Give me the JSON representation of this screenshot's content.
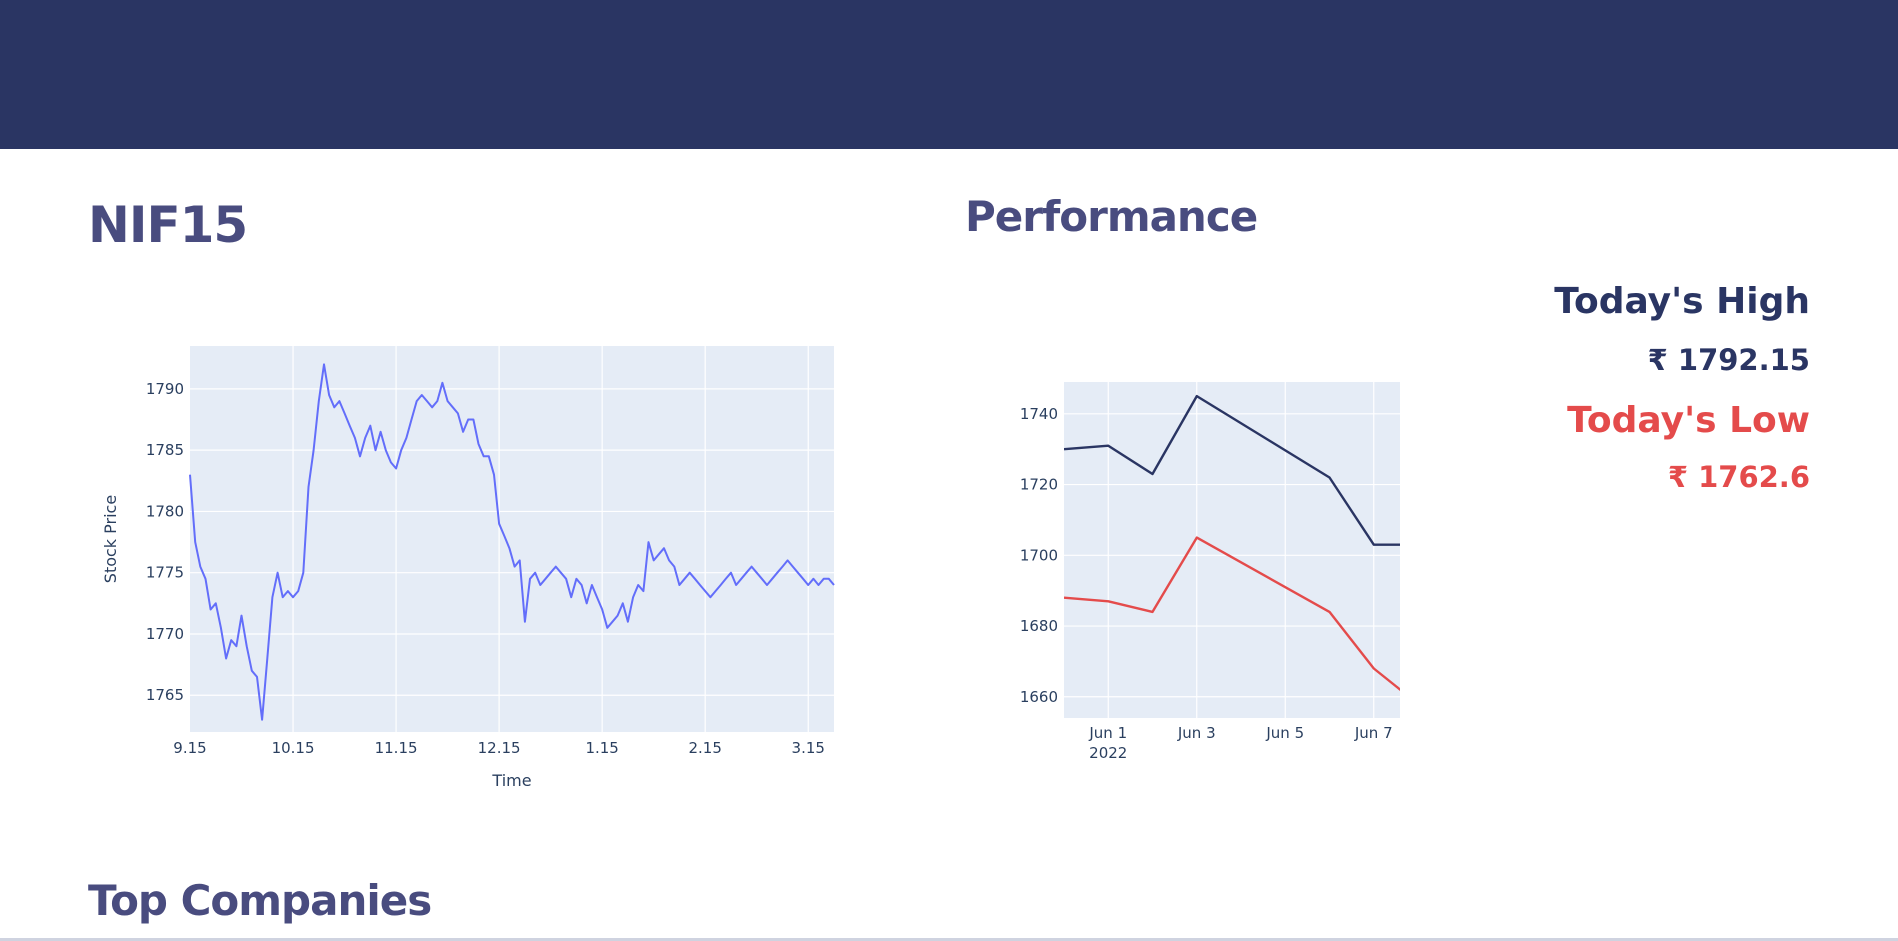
{
  "header": {
    "color": "#2a3563"
  },
  "ticker": "NIF15",
  "performance_title": "Performance",
  "stats": {
    "high_label": "Today's High",
    "high_value": "₹ 1792.15",
    "low_label": "Today's Low",
    "low_value": "₹ 1762.6",
    "high_color": "#2a3563",
    "low_color": "#e44b4b"
  },
  "section_title": "Top Companies",
  "chart_data": [
    {
      "type": "line",
      "title": "",
      "xlabel": "Time",
      "ylabel": "Stock Price",
      "x_ticks": [
        "9.15",
        "10.15",
        "11.15",
        "12.15",
        "1.15",
        "2.15",
        "3.15"
      ],
      "y_ticks": [
        1765,
        1770,
        1775,
        1780,
        1785,
        1790
      ],
      "xlim": [
        9.25,
        15.5
      ],
      "ylim": [
        1762.0,
        1793.5
      ],
      "line_color": "#636efa",
      "grid": true,
      "series": [
        {
          "x": [
            9.25,
            9.3,
            9.35,
            9.4,
            9.45,
            9.5,
            9.55,
            9.6,
            9.65,
            9.7,
            9.75,
            9.8,
            9.85,
            9.9,
            9.95,
            10.0,
            10.05,
            10.1,
            10.15,
            10.2,
            10.25,
            10.3,
            10.35,
            10.4,
            10.45,
            10.5,
            10.55,
            10.6,
            10.65,
            10.7,
            10.75,
            10.8,
            10.85,
            10.9,
            10.95,
            11.0,
            11.05,
            11.1,
            11.15,
            11.2,
            11.25,
            11.3,
            11.35,
            11.4,
            11.45,
            11.5,
            11.55,
            11.6,
            11.65,
            11.7,
            11.75,
            11.8,
            11.85,
            11.9,
            11.95,
            12.0,
            12.05,
            12.1,
            12.15,
            12.2,
            12.25,
            12.3,
            12.35,
            12.4,
            12.45,
            12.5,
            12.55,
            12.6,
            12.65,
            12.7,
            12.75,
            12.8,
            12.85,
            12.9,
            12.95,
            13.0,
            13.05,
            13.1,
            13.15,
            13.2,
            13.25,
            13.3,
            13.35,
            13.4,
            13.45,
            13.5,
            13.55,
            13.6,
            13.65,
            13.7,
            13.75,
            13.8,
            13.85,
            13.9,
            13.95,
            14.0,
            14.05,
            14.1,
            14.15,
            14.2,
            14.25,
            14.3,
            14.35,
            14.4,
            14.45,
            14.5,
            14.55,
            14.6,
            14.65,
            14.7,
            14.75,
            14.8,
            14.85,
            14.9,
            14.95,
            15.0,
            15.05,
            15.1,
            15.15,
            15.2,
            15.25,
            15.3,
            15.35,
            15.4,
            15.45,
            15.5
          ],
          "values": [
            1783.0,
            1777.5,
            1775.5,
            1774.5,
            1772.0,
            1772.5,
            1770.5,
            1768.0,
            1769.5,
            1769.0,
            1771.5,
            1769.0,
            1767.0,
            1766.5,
            1763.0,
            1768.0,
            1773.0,
            1775.0,
            1773.0,
            1773.5,
            1773.0,
            1773.5,
            1775.0,
            1782.0,
            1785.0,
            1789.0,
            1792.0,
            1789.5,
            1788.5,
            1789.0,
            1788.0,
            1787.0,
            1786.0,
            1784.5,
            1786.0,
            1787.0,
            1785.0,
            1786.5,
            1785.0,
            1784.0,
            1783.5,
            1785.0,
            1786.0,
            1787.5,
            1789.0,
            1789.5,
            1789.0,
            1788.5,
            1789.0,
            1790.5,
            1789.0,
            1788.5,
            1788.0,
            1786.5,
            1787.5,
            1787.5,
            1785.5,
            1784.5,
            1784.5,
            1783.0,
            1779.0,
            1778.0,
            1777.0,
            1775.5,
            1776.0,
            1771.0,
            1774.5,
            1775.0,
            1774.0,
            1774.5,
            1775.0,
            1775.5,
            1775.0,
            1774.5,
            1773.0,
            1774.5,
            1774.0,
            1772.5,
            1774.0,
            1773.0,
            1772.0,
            1770.5,
            1771.0,
            1771.5,
            1772.5,
            1771.0,
            1773.0,
            1774.0,
            1773.5,
            1777.5,
            1776.0,
            1776.5,
            1777.0,
            1776.0,
            1775.5,
            1774.0,
            1774.5,
            1775.0,
            1774.5,
            1774.0,
            1773.5,
            1773.0,
            1773.5,
            1774.0,
            1774.5,
            1775.0,
            1774.0,
            1774.5,
            1775.0,
            1775.5,
            1775.0,
            1774.5,
            1774.0,
            1774.5,
            1775.0,
            1775.5,
            1776.0,
            1775.5,
            1775.0,
            1774.5,
            1774.0,
            1774.5,
            1774.0,
            1774.5,
            1774.5,
            1774.0
          ]
        }
      ]
    },
    {
      "type": "line",
      "title": "",
      "x_ticks": [
        "Jun 1",
        "Jun 3",
        "Jun 5",
        "Jun 7"
      ],
      "x_year": "2022",
      "y_ticks": [
        1660,
        1680,
        1700,
        1720,
        1740
      ],
      "xlim": [
        "2022-05-31",
        "2022-06-08"
      ],
      "ylim": [
        1654,
        1749
      ],
      "grid": true,
      "series": [
        {
          "color": "#2a3563",
          "x": [
            "2022-05-31",
            "2022-06-01",
            "2022-06-02",
            "2022-06-03",
            "2022-06-06",
            "2022-06-07",
            "2022-06-08"
          ],
          "values": [
            1730,
            1731,
            1723,
            1745,
            1722,
            1703,
            1703
          ]
        },
        {
          "color": "#e44b4b",
          "x": [
            "2022-05-31",
            "2022-06-01",
            "2022-06-02",
            "2022-06-03",
            "2022-06-06",
            "2022-06-07",
            "2022-06-08"
          ],
          "values": [
            1688,
            1687,
            1684,
            1705,
            1684,
            1668,
            1658
          ]
        }
      ]
    }
  ]
}
